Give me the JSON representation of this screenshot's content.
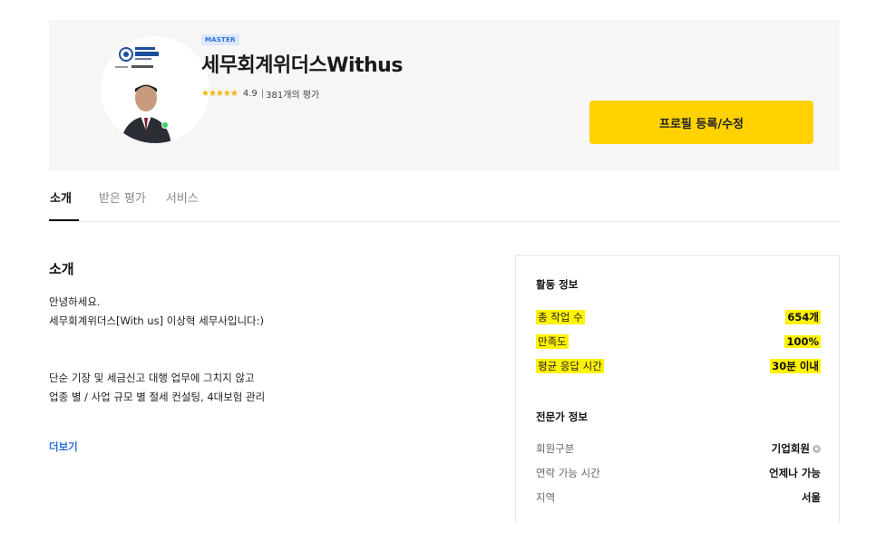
{
  "header": {
    "badge": "MASTER",
    "name": "세무회계위더스Withus",
    "stars": "★★★★★",
    "rating": "4.9",
    "separator": "|",
    "review_count": "381개의 평가",
    "edit_button": "프로필 등록/수정"
  },
  "tabs": [
    {
      "label": "소개",
      "active": true
    },
    {
      "label": "받은 평가",
      "active": false
    },
    {
      "label": "서비스",
      "active": false
    }
  ],
  "intro": {
    "title": "소개",
    "lines": [
      "안녕하세요.",
      "세무회계위더스[With us] 이상혁 세무사입니다:)",
      "단순 기장 및 세금신고 대행 업무에 그치지 않고",
      "업종 별 / 사업 규모 별 절세 컨설팅, 4대보험 관리"
    ],
    "more": "더보기"
  },
  "activity": {
    "title": "활동 정보",
    "items": [
      {
        "label": "총 작업 수",
        "value": "654개"
      },
      {
        "label": "만족도",
        "value": "100%"
      },
      {
        "label": "평균 응답 시간",
        "value": "30분 이내"
      }
    ]
  },
  "expert": {
    "title": "전문가 정보",
    "items": [
      {
        "label": "회원구분",
        "value": "기업회원"
      },
      {
        "label": "연락 가능 시간",
        "value": "언제나 가능"
      },
      {
        "label": "지역",
        "value": "서울"
      }
    ]
  },
  "colors": {
    "accent_yellow": "#ffd200",
    "highlight": "#fff200",
    "link_blue": "#2f6fd8",
    "online_green": "#3bd16f"
  },
  "icons": {
    "avatar_logo": "tax-firm-logo",
    "help": "help-circle-icon",
    "rating": "star-icon"
  }
}
